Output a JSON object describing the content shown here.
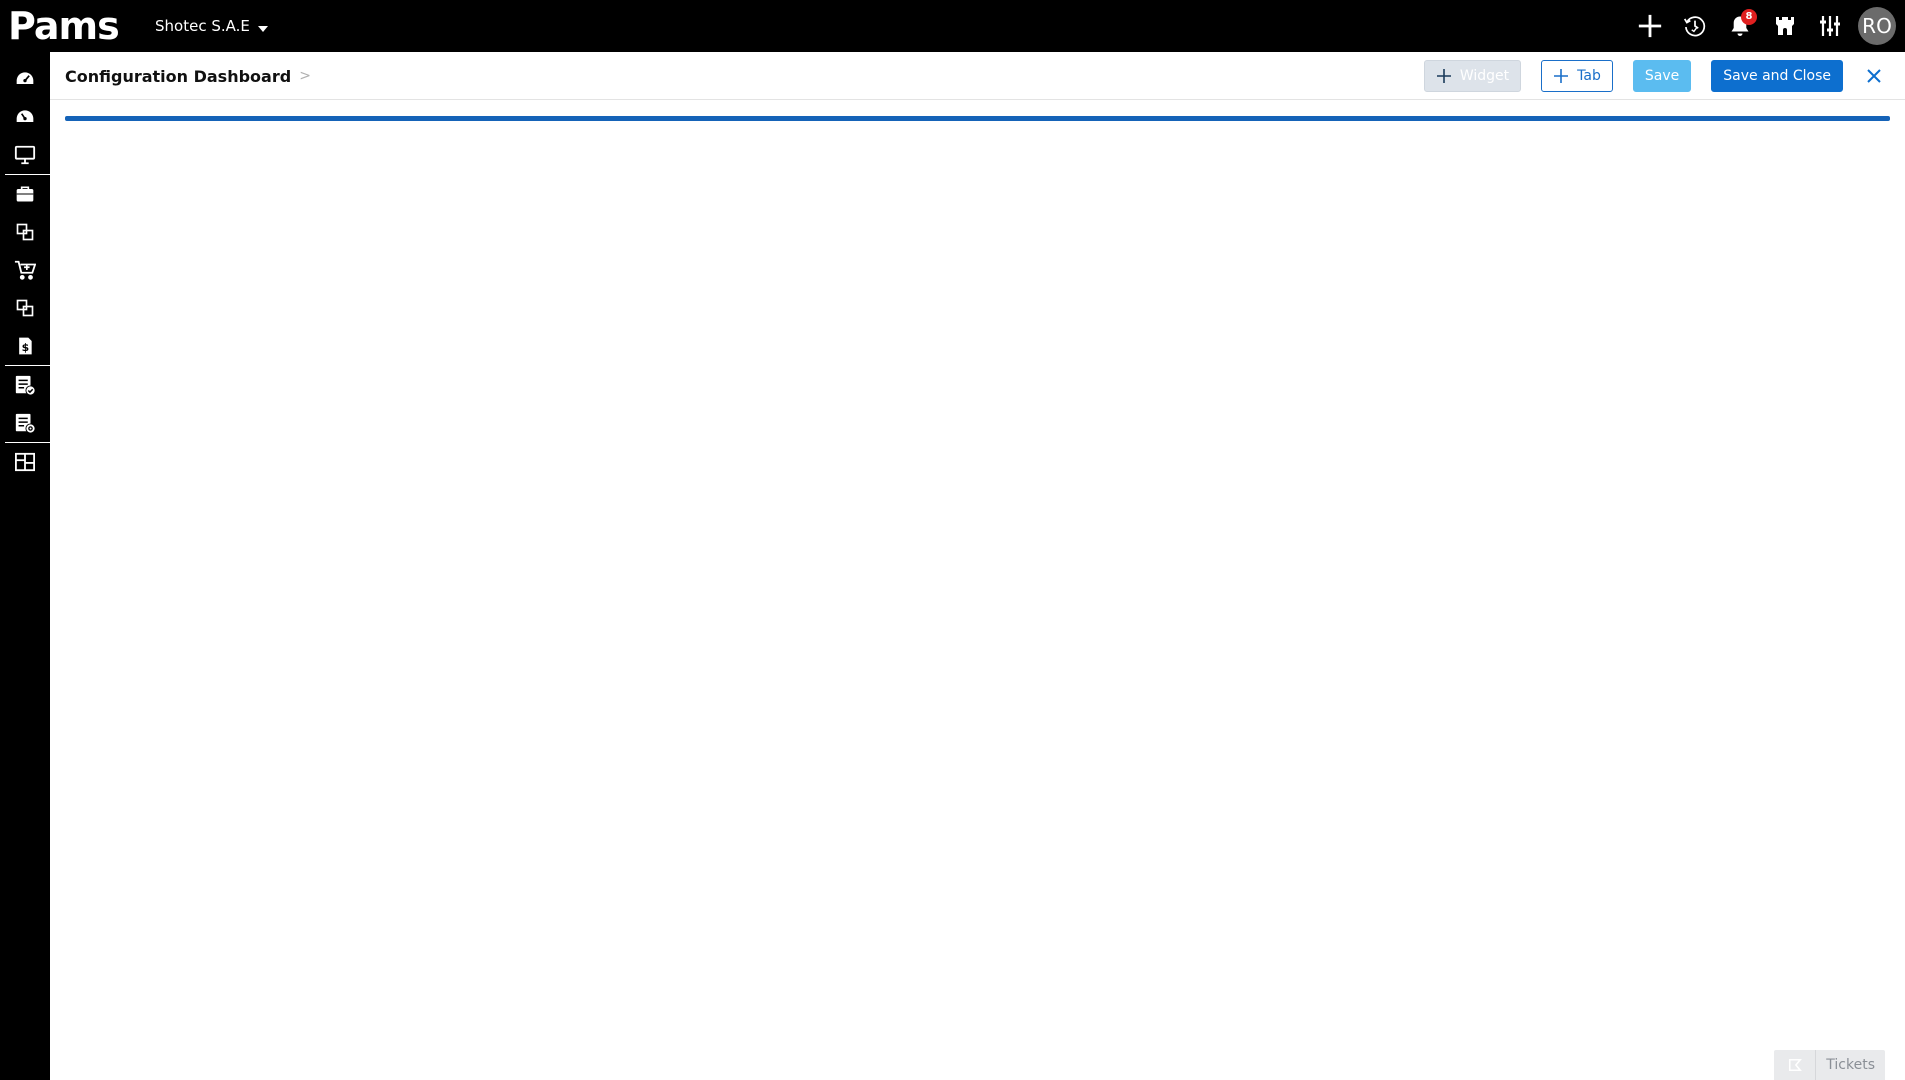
{
  "brand": {
    "logo_text": "Pams"
  },
  "topbar": {
    "org_name": "Shotec S.A.E",
    "icons": [
      "add-icon",
      "history-icon",
      "bell-icon",
      "castle-icon",
      "sliders-icon"
    ],
    "notification_count": "8",
    "avatar_initials": "RO"
  },
  "sidebar": {
    "items": [
      "dashboard-icon",
      "dashboard-alt-icon",
      "monitor-icon",
      "briefcase-icon",
      "modules-icon",
      "cart-icon",
      "modules-alt-icon",
      "invoice-icon",
      "report-check-icon",
      "report-settings-icon",
      "layout-icon"
    ]
  },
  "header": {
    "title": "Configuration Dashboard",
    "breadcrumb_sep": ">",
    "buttons": {
      "widget": "Widget",
      "tab": "Tab",
      "save": "Save",
      "save_close": "Save and Close"
    }
  },
  "progress": {
    "value_percent": 100,
    "color": "#1563b8"
  },
  "footer": {
    "tickets_label": "Tickets"
  },
  "colors": {
    "topbar_bg": "#000000",
    "primary": "#0d6fcf",
    "save_light": "#5bbcf0",
    "badge": "#e02020"
  }
}
